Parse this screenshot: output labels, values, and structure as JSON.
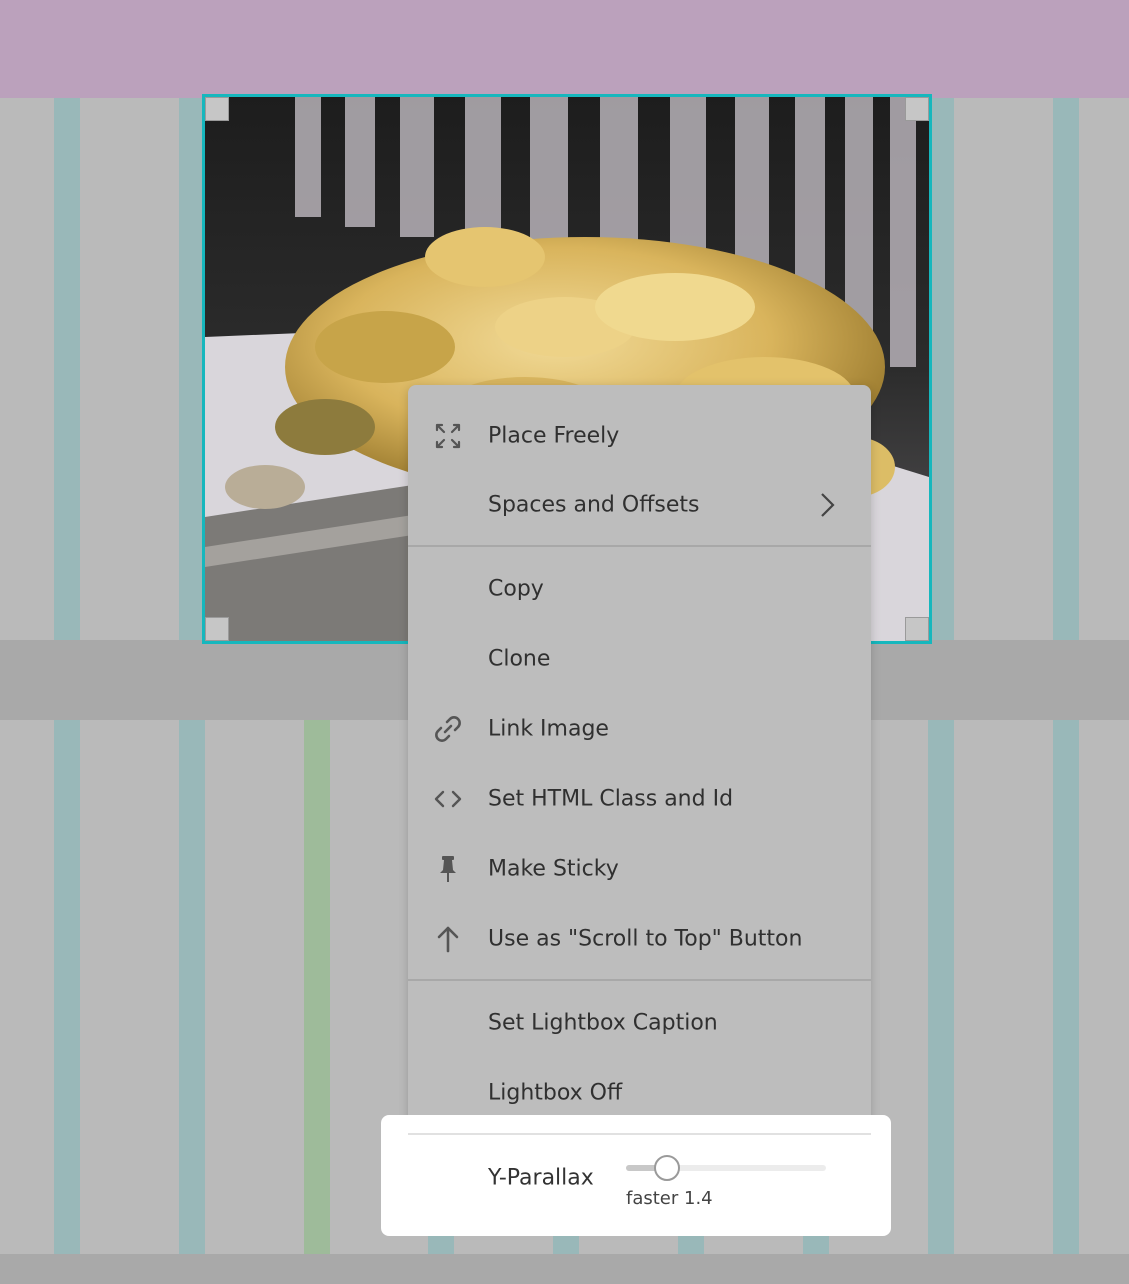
{
  "menu": {
    "items": [
      {
        "label": "Place Freely",
        "icon": "expand-arrows-icon"
      },
      {
        "label": "Spaces and Offsets",
        "icon": "",
        "submenu": true
      },
      {
        "label": "Copy",
        "icon": ""
      },
      {
        "label": "Clone",
        "icon": ""
      },
      {
        "label": "Link Image",
        "icon": "link-icon"
      },
      {
        "label": "Set HTML Class and Id",
        "icon": "code-icon"
      },
      {
        "label": "Make Sticky",
        "icon": "pin-icon"
      },
      {
        "label": "Use as \"Scroll to Top\" Button",
        "icon": "arrow-up-icon"
      },
      {
        "label": "Set Lightbox Caption",
        "icon": ""
      },
      {
        "label": "Lightbox Off",
        "icon": ""
      }
    ]
  },
  "parallax": {
    "label": "Y-Parallax",
    "value_text": "faster 1.4",
    "slider_fraction": 0.2
  },
  "colors": {
    "selection_border": "#16b7bd",
    "header_band": "#bba1bc",
    "grid_column": "#99b8b9",
    "grid_column_highlight": "#9ebb9a"
  }
}
